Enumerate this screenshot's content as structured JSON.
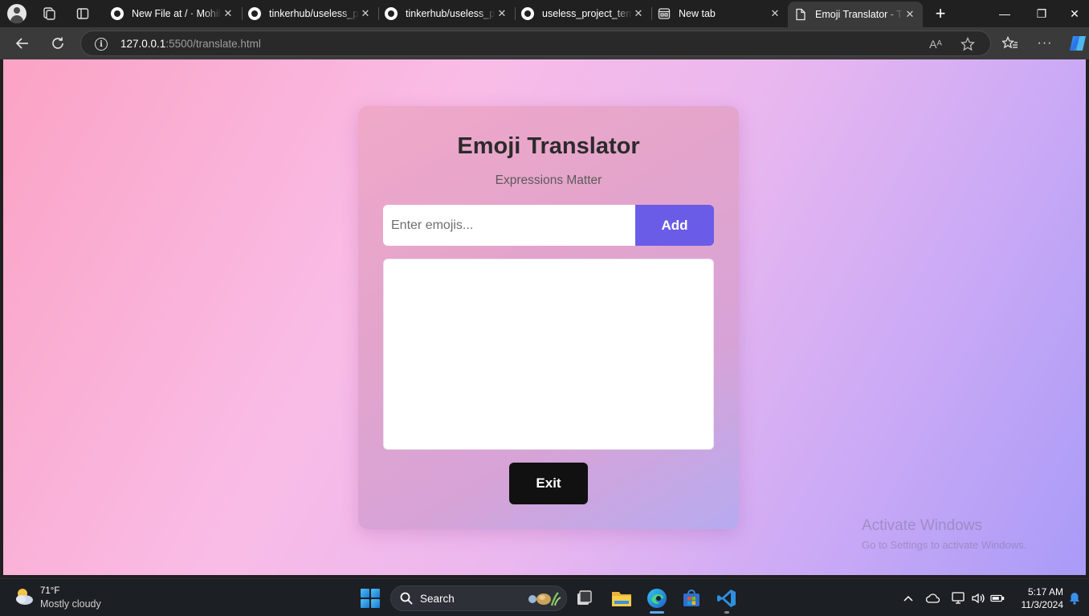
{
  "browser": {
    "tabs": [
      {
        "label": "New File at / · Mohile",
        "icon": "github-icon"
      },
      {
        "label": "tinkerhub/useless_pr",
        "icon": "github-icon"
      },
      {
        "label": "tinkerhub/useless_pr",
        "icon": "github-icon"
      },
      {
        "label": "useless_project_temp",
        "icon": "github-icon"
      },
      {
        "label": "New tab",
        "icon": "new-tab-icon"
      },
      {
        "label": "Emoji Translator - Tr",
        "icon": "page-icon",
        "active": true
      }
    ],
    "new_tab_symbol": "+",
    "window_controls": {
      "minimize": "—",
      "restore": "❐",
      "close": "✕"
    },
    "address": {
      "host": "127.0.0.1",
      "path": ":5500/translate.html"
    },
    "read_aloud_label": "Aᴬ"
  },
  "app": {
    "title": "Emoji Translator",
    "subtitle": "Expressions Matter",
    "input_placeholder": "Enter emojis...",
    "input_value": "",
    "add_label": "Add",
    "exit_label": "Exit",
    "accent_color": "#6b5ce7"
  },
  "watermark": {
    "line1": "Activate Windows",
    "line2": "Go to Settings to activate Windows."
  },
  "taskbar": {
    "weather_temp": "71°F",
    "weather_desc": "Mostly cloudy",
    "search_label": "Search",
    "time": "5:17 AM",
    "date": "11/3/2024"
  }
}
